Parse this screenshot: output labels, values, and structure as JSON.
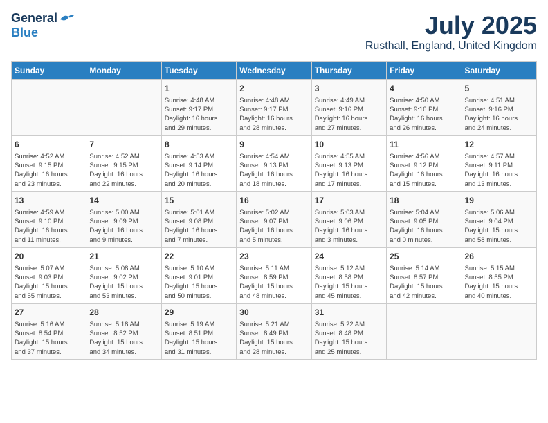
{
  "header": {
    "logo_general": "General",
    "logo_blue": "Blue",
    "month": "July 2025",
    "location": "Rusthall, England, United Kingdom"
  },
  "days_of_week": [
    "Sunday",
    "Monday",
    "Tuesday",
    "Wednesday",
    "Thursday",
    "Friday",
    "Saturday"
  ],
  "weeks": [
    [
      {
        "day": "",
        "info": ""
      },
      {
        "day": "",
        "info": ""
      },
      {
        "day": "1",
        "info": "Sunrise: 4:48 AM\nSunset: 9:17 PM\nDaylight: 16 hours\nand 29 minutes."
      },
      {
        "day": "2",
        "info": "Sunrise: 4:48 AM\nSunset: 9:17 PM\nDaylight: 16 hours\nand 28 minutes."
      },
      {
        "day": "3",
        "info": "Sunrise: 4:49 AM\nSunset: 9:16 PM\nDaylight: 16 hours\nand 27 minutes."
      },
      {
        "day": "4",
        "info": "Sunrise: 4:50 AM\nSunset: 9:16 PM\nDaylight: 16 hours\nand 26 minutes."
      },
      {
        "day": "5",
        "info": "Sunrise: 4:51 AM\nSunset: 9:16 PM\nDaylight: 16 hours\nand 24 minutes."
      }
    ],
    [
      {
        "day": "6",
        "info": "Sunrise: 4:52 AM\nSunset: 9:15 PM\nDaylight: 16 hours\nand 23 minutes."
      },
      {
        "day": "7",
        "info": "Sunrise: 4:52 AM\nSunset: 9:15 PM\nDaylight: 16 hours\nand 22 minutes."
      },
      {
        "day": "8",
        "info": "Sunrise: 4:53 AM\nSunset: 9:14 PM\nDaylight: 16 hours\nand 20 minutes."
      },
      {
        "day": "9",
        "info": "Sunrise: 4:54 AM\nSunset: 9:13 PM\nDaylight: 16 hours\nand 18 minutes."
      },
      {
        "day": "10",
        "info": "Sunrise: 4:55 AM\nSunset: 9:13 PM\nDaylight: 16 hours\nand 17 minutes."
      },
      {
        "day": "11",
        "info": "Sunrise: 4:56 AM\nSunset: 9:12 PM\nDaylight: 16 hours\nand 15 minutes."
      },
      {
        "day": "12",
        "info": "Sunrise: 4:57 AM\nSunset: 9:11 PM\nDaylight: 16 hours\nand 13 minutes."
      }
    ],
    [
      {
        "day": "13",
        "info": "Sunrise: 4:59 AM\nSunset: 9:10 PM\nDaylight: 16 hours\nand 11 minutes."
      },
      {
        "day": "14",
        "info": "Sunrise: 5:00 AM\nSunset: 9:09 PM\nDaylight: 16 hours\nand 9 minutes."
      },
      {
        "day": "15",
        "info": "Sunrise: 5:01 AM\nSunset: 9:08 PM\nDaylight: 16 hours\nand 7 minutes."
      },
      {
        "day": "16",
        "info": "Sunrise: 5:02 AM\nSunset: 9:07 PM\nDaylight: 16 hours\nand 5 minutes."
      },
      {
        "day": "17",
        "info": "Sunrise: 5:03 AM\nSunset: 9:06 PM\nDaylight: 16 hours\nand 3 minutes."
      },
      {
        "day": "18",
        "info": "Sunrise: 5:04 AM\nSunset: 9:05 PM\nDaylight: 16 hours\nand 0 minutes."
      },
      {
        "day": "19",
        "info": "Sunrise: 5:06 AM\nSunset: 9:04 PM\nDaylight: 15 hours\nand 58 minutes."
      }
    ],
    [
      {
        "day": "20",
        "info": "Sunrise: 5:07 AM\nSunset: 9:03 PM\nDaylight: 15 hours\nand 55 minutes."
      },
      {
        "day": "21",
        "info": "Sunrise: 5:08 AM\nSunset: 9:02 PM\nDaylight: 15 hours\nand 53 minutes."
      },
      {
        "day": "22",
        "info": "Sunrise: 5:10 AM\nSunset: 9:01 PM\nDaylight: 15 hours\nand 50 minutes."
      },
      {
        "day": "23",
        "info": "Sunrise: 5:11 AM\nSunset: 8:59 PM\nDaylight: 15 hours\nand 48 minutes."
      },
      {
        "day": "24",
        "info": "Sunrise: 5:12 AM\nSunset: 8:58 PM\nDaylight: 15 hours\nand 45 minutes."
      },
      {
        "day": "25",
        "info": "Sunrise: 5:14 AM\nSunset: 8:57 PM\nDaylight: 15 hours\nand 42 minutes."
      },
      {
        "day": "26",
        "info": "Sunrise: 5:15 AM\nSunset: 8:55 PM\nDaylight: 15 hours\nand 40 minutes."
      }
    ],
    [
      {
        "day": "27",
        "info": "Sunrise: 5:16 AM\nSunset: 8:54 PM\nDaylight: 15 hours\nand 37 minutes."
      },
      {
        "day": "28",
        "info": "Sunrise: 5:18 AM\nSunset: 8:52 PM\nDaylight: 15 hours\nand 34 minutes."
      },
      {
        "day": "29",
        "info": "Sunrise: 5:19 AM\nSunset: 8:51 PM\nDaylight: 15 hours\nand 31 minutes."
      },
      {
        "day": "30",
        "info": "Sunrise: 5:21 AM\nSunset: 8:49 PM\nDaylight: 15 hours\nand 28 minutes."
      },
      {
        "day": "31",
        "info": "Sunrise: 5:22 AM\nSunset: 8:48 PM\nDaylight: 15 hours\nand 25 minutes."
      },
      {
        "day": "",
        "info": ""
      },
      {
        "day": "",
        "info": ""
      }
    ]
  ]
}
